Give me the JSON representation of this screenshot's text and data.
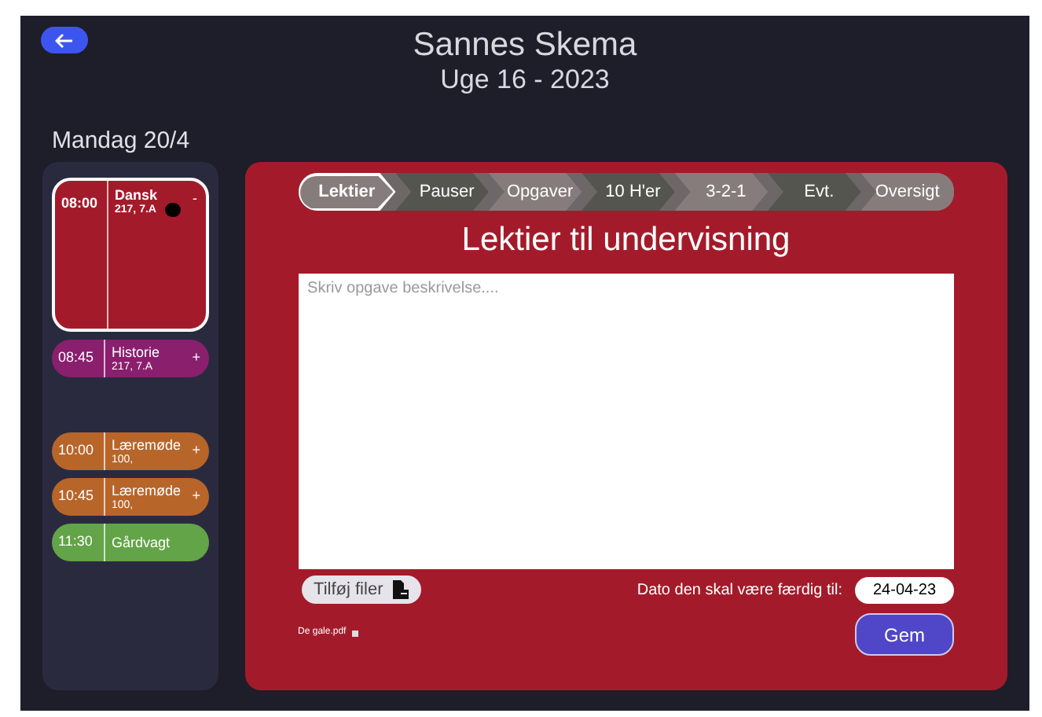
{
  "header": {
    "title": "Sannes Skema",
    "subtitle": "Uge 16 - 2023"
  },
  "day": {
    "label": "Mandag 20/4",
    "events": [
      {
        "time": "08:00",
        "title": "Dansk",
        "room": "217, 7.A",
        "sign": "-",
        "color": "#a31b2a",
        "selected": true,
        "dot": true,
        "gap_before": false
      },
      {
        "time": "08:45",
        "title": "Historie",
        "room": "217, 7.A",
        "sign": "+",
        "color": "#8a1f6e",
        "selected": false,
        "dot": false,
        "gap_before": false
      },
      {
        "time": "10:00",
        "title": "Læremøde",
        "room": "100,",
        "sign": "+",
        "color": "#b8652a",
        "selected": false,
        "dot": false,
        "gap_before": true
      },
      {
        "time": "10:45",
        "title": "Læremøde",
        "room": "100,",
        "sign": "+",
        "color": "#b8652a",
        "selected": false,
        "dot": false,
        "gap_before": false
      },
      {
        "time": "11:30",
        "title": "Gårdvagt",
        "color": "#62a447",
        "selected": false,
        "dot": false,
        "gap_before": false
      }
    ]
  },
  "steps": [
    {
      "label": "Lektier",
      "selected": true
    },
    {
      "label": "Pauser",
      "selected": false
    },
    {
      "label": "Opgaver",
      "selected": false
    },
    {
      "label": "10 H'er",
      "selected": false
    },
    {
      "label": "3-2-1",
      "selected": false
    },
    {
      "label": "Evt.",
      "selected": false
    },
    {
      "label": "Oversigt",
      "selected": false
    }
  ],
  "panel": {
    "heading": "Lektier til undervisning",
    "description": {
      "placeholder": "Skriv opgave beskrivelse...."
    },
    "add_files": "Tilføj filer",
    "due_label": "Dato den skal være færdig til:",
    "due_date": "24-04-23",
    "files": [
      "De gale.pdf"
    ],
    "save": "Gem"
  }
}
